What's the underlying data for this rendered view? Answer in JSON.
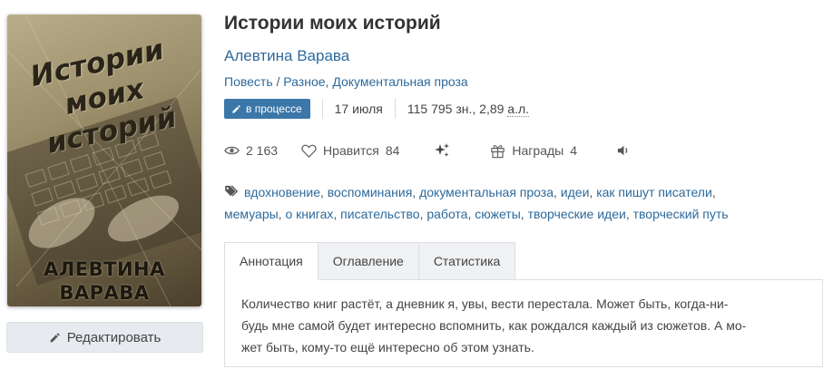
{
  "cover": {
    "title_line1": "Истории",
    "title_line2": "моих историй",
    "author_line1": "АЛЕВТИНА",
    "author_line2": "ВАРАВА"
  },
  "edit_button": {
    "label": "Редактировать",
    "icon": "pencil-icon"
  },
  "book": {
    "title": "Истории моих историй",
    "author": "Алевтина Варава",
    "genre_form": "Повесть",
    "genre_sep": " / ",
    "genre_1": "Разное",
    "genre_comma": ", ",
    "genre_2": "Документальная проза"
  },
  "status": {
    "badge": "в процессе",
    "date": "17 июля",
    "size_chars": "115 795 зн., 2,89 ",
    "size_unit": "а.л."
  },
  "stats": {
    "views": "2 163",
    "likes_label": "Нравится",
    "likes_count": "84",
    "awards_label": "Награды",
    "awards_count": "4"
  },
  "tags": [
    "вдохновение",
    "воспоминания",
    "документальная проза",
    "идеи",
    "как пишут писатели",
    "мемуары",
    "о книгах",
    "писательство",
    "работа",
    "сюжеты",
    "творческие идеи",
    "творческий путь"
  ],
  "tabs": [
    "Аннотация",
    "Оглавление",
    "Статистика"
  ],
  "annotation": {
    "line1": "Количество книг растёт, а дневник я, увы, вести перестала. Может быть, когда-ни-",
    "line2": "будь мне самой будет интересно вспомнить, как рождался каждый из сюжетов. А мо-",
    "line3": "жет быть, кому-то ещё интересно об этом узнать."
  },
  "colors": {
    "link": "#2d6a9c",
    "badge": "#3b77a8",
    "tab_bg": "#f0f1f3"
  }
}
